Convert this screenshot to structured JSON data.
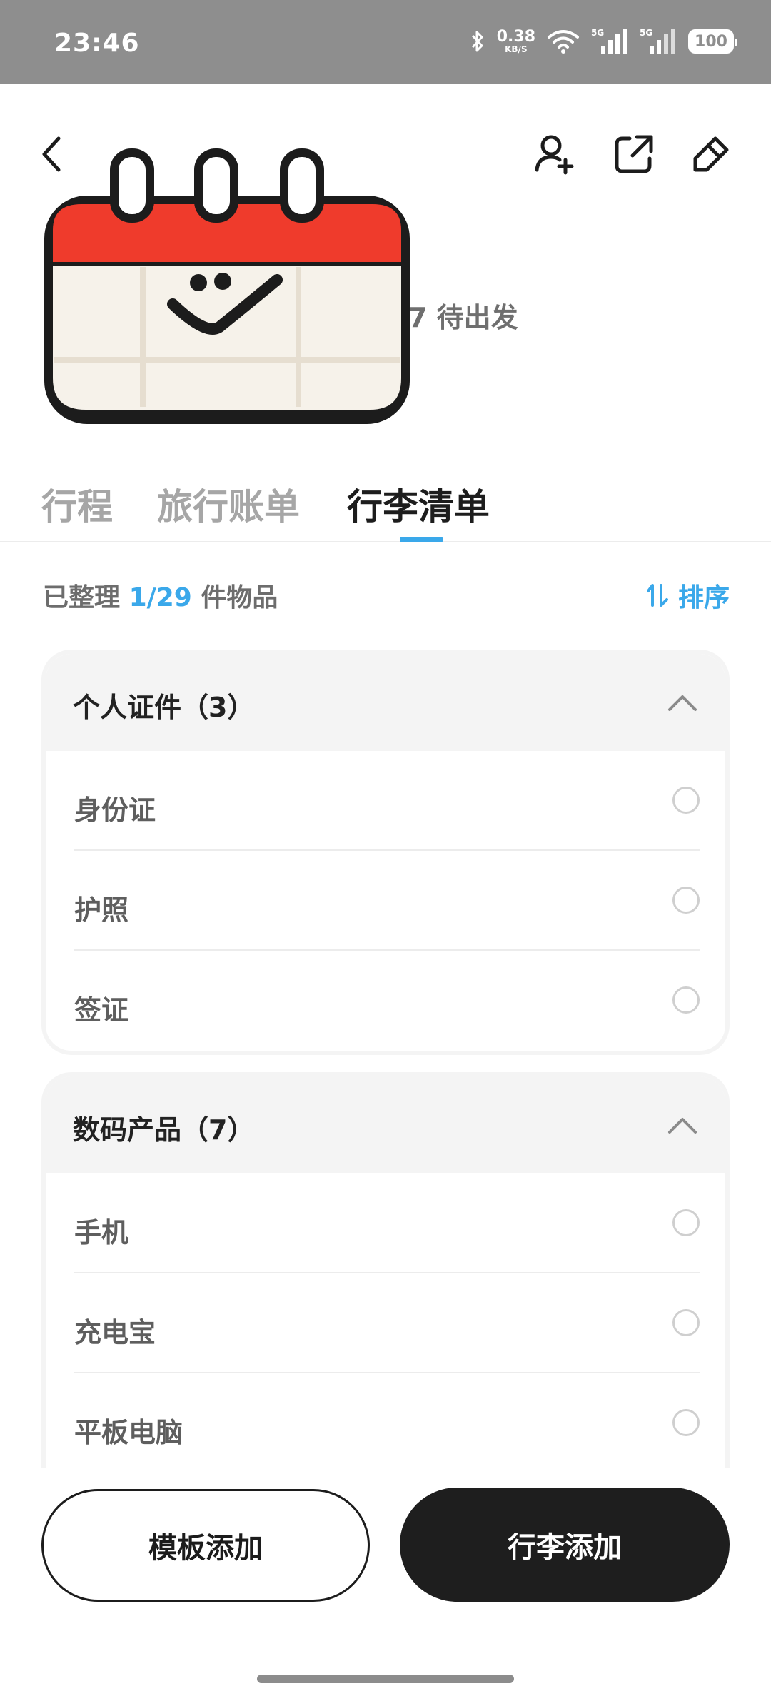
{
  "status_bar": {
    "time": "23:46",
    "net_speed_value": "0.38",
    "net_speed_unit": "KB/S",
    "signal_label_1": "5G",
    "signal_label_2": "5G",
    "battery": "100"
  },
  "header": {
    "trip_status": "7 待出发",
    "icons": [
      "back-icon",
      "add-member-icon",
      "share-icon",
      "edit-icon"
    ]
  },
  "tabs": [
    {
      "label": "行程"
    },
    {
      "label": "旅行账单"
    },
    {
      "label": "行李清单"
    }
  ],
  "summary": {
    "prefix": "已整理",
    "count": "1/29",
    "suffix": "件物品",
    "sort_label": "排序"
  },
  "categories": [
    {
      "title": "个人证件（3）",
      "items": [
        {
          "name": "身份证",
          "checked": false
        },
        {
          "name": "护照",
          "checked": false
        },
        {
          "name": "签证",
          "checked": false
        }
      ]
    },
    {
      "title": "数码产品（7）",
      "items": [
        {
          "name": "手机",
          "checked": false
        },
        {
          "name": "充电宝",
          "checked": false
        },
        {
          "name": "平板电脑",
          "checked": false
        }
      ]
    }
  ],
  "bottom": {
    "template_add": "模板添加",
    "luggage_add": "行李添加"
  },
  "colors": {
    "accent": "#3aa8ea",
    "dark_button": "#1e1e1e",
    "calendar_red": "#ef3b2c"
  }
}
